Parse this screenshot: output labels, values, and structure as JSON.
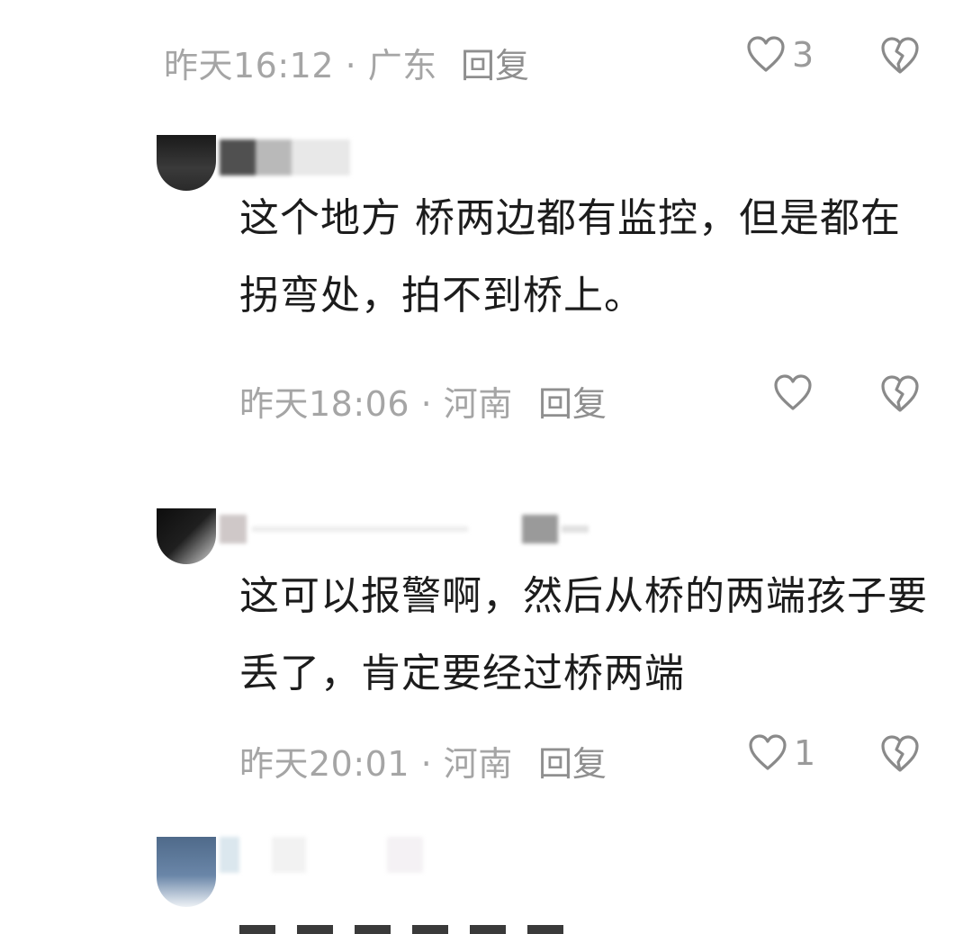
{
  "top_comment": {
    "cropped_text": "",
    "time_location": "昨天16:12 · 广东",
    "reply_label": "回复",
    "like_count": "3"
  },
  "comments": [
    {
      "text_line1": "这个地方 桥两边都有监控，但是都在",
      "text_line2": "拐弯处，拍不到桥上。",
      "time_location": "昨天18:06 · 河南",
      "reply_label": "回复",
      "like_count": ""
    },
    {
      "text_line1": "这可以报警啊，然后从桥的两端孩子要",
      "text_line2": "丢了，肯定要经过桥两端",
      "time_location": "昨天20:01 · 河南",
      "reply_label": "回复",
      "like_count": "1"
    }
  ],
  "icons": {
    "like": "heart-outline-icon",
    "dislike": "broken-heart-icon"
  },
  "colors": {
    "meta_text": "#a5a5a5",
    "body_text": "#1c1c1c",
    "icon_stroke": "#8a8a8a"
  }
}
